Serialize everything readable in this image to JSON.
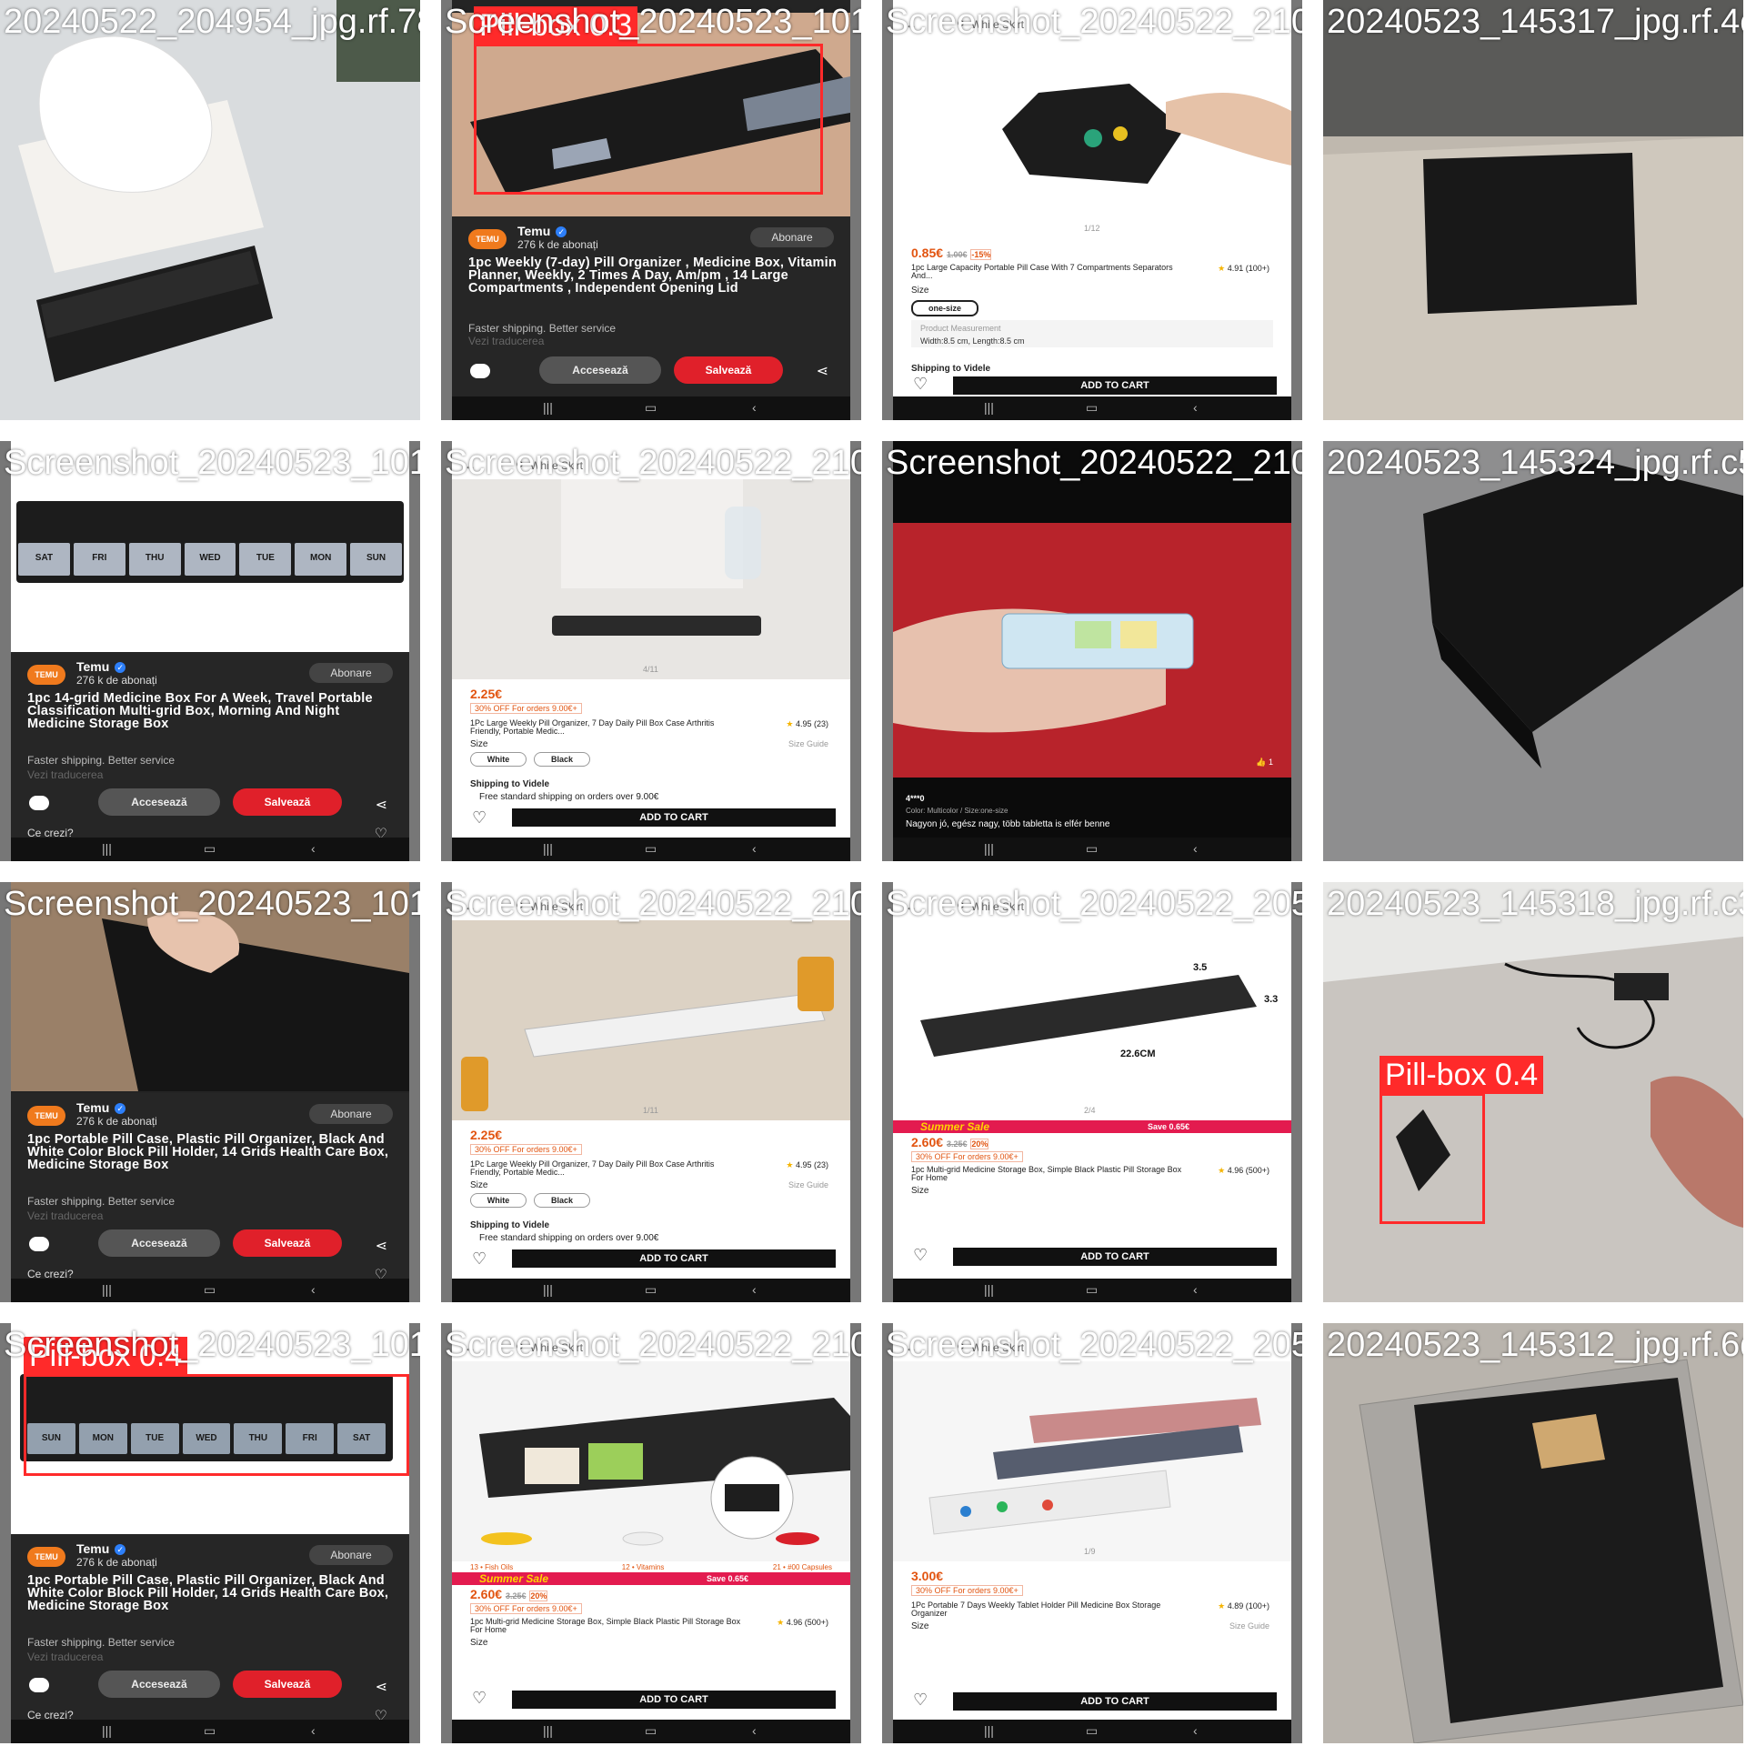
{
  "tiles": [
    {
      "filename": "20240522_204954_jpg.rf.783…"
    },
    {
      "filename": "Screenshot_20240523_10115…",
      "detection": {
        "label": "Pill-box 0.3"
      },
      "post": {
        "seller": "Temu",
        "subscribers": "276 k de abonați",
        "follow": "Abonare",
        "title": "1pc Weekly (7-day) Pill Organizer , Medicine Box, Vitamin Planner, Weekly, 2 Times A Day, Am/pm , 14 Large Compartments , Independent Opening Lid",
        "faster": "Faster shipping. Better service",
        "translate": "Vezi traducerea",
        "access": "Accesează",
        "save": "Salvează"
      }
    },
    {
      "filename": "Screenshot_20240522_21012…",
      "shop": {
        "search": "White Skirt",
        "price": "0.85€",
        "old_price": "1.00€",
        "discount": "-15%",
        "desc": "1pc Large Capacity Portable Pill Case With 7 Compartments Separators And...",
        "rating": "4.91 (100+)",
        "size_label": "Size",
        "size_value": "one-size",
        "measure": "Product Measurement",
        "measure_value": "Width:8.5 cm, Length:8.5 cm",
        "ship": "Shipping to Videle",
        "cart": "ADD TO CART",
        "counter": "1/12"
      }
    },
    {
      "filename": "20240523_145317_jpg.rf.4c…"
    },
    {
      "filename": "Screenshot_20240523_10117…",
      "post": {
        "seller": "Temu",
        "subscribers": "276 k de abonați",
        "follow": "Abonare",
        "title": "1pc 14-grid Medicine Box For A Week, Travel Portable Classification Multi-grid Box, Morning And Night Medicine Storage Box",
        "faster": "Faster shipping. Better service",
        "translate": "Vezi traducerea",
        "access": "Accesează",
        "save": "Salvează",
        "ce": "Ce crezi?"
      },
      "days": [
        "SAT",
        "FRI",
        "THU",
        "WED",
        "TUE",
        "MON",
        "SUN"
      ]
    },
    {
      "filename": "Screenshot_20240522_21024…",
      "shop": {
        "search": "White Skirt",
        "price": "2.25€",
        "promo": "30% OFF For orders 9.00€+",
        "desc": "1Pc Large Weekly Pill Organizer, 7 Day Daily Pill Box Case Arthritis Friendly, Portable Medic...",
        "rating": "4.95 (23)",
        "size_label": "Size",
        "size_guide": "Size Guide",
        "chips": [
          "White",
          "Black"
        ],
        "ship": "Shipping to Videle",
        "ship_note": "Free standard shipping on orders over 9.00€",
        "cart": "ADD TO CART",
        "counter": "4/11"
      }
    },
    {
      "filename": "Screenshot_20240522_21005…",
      "review": {
        "user": "4***0",
        "variant": "Color: Multicolor / Size:one-size",
        "text": "Nagyon jó, egész nagy, több tabletta is elfér benne",
        "likes": "1"
      }
    },
    {
      "filename": "20240523_145324_jpg.rf.c5…"
    },
    {
      "filename": "Screenshot_20240523_10123…",
      "post": {
        "seller": "Temu",
        "subscribers": "276 k de abonați",
        "follow": "Abonare",
        "title": "1pc Portable Pill Case, Plastic Pill Organizer, Black And White Color Block Pill Holder, 14 Grids Health Care Box, Medicine Storage Box",
        "faster": "Faster shipping. Better service",
        "translate": "Vezi traducerea",
        "access": "Accesează",
        "save": "Salvează",
        "ce": "Ce crezi?"
      }
    },
    {
      "filename": "Screenshot_20240522_21023…",
      "shop": {
        "search": "White Skirt",
        "price": "2.25€",
        "promo": "30% OFF For orders 9.00€+",
        "desc": "1Pc Large Weekly Pill Organizer, 7 Day Daily Pill Box Case Arthritis Friendly, Portable Medic...",
        "rating": "4.95 (23)",
        "size_label": "Size",
        "size_guide": "Size Guide",
        "chips": [
          "White",
          "Black"
        ],
        "ship": "Shipping to Videle",
        "ship_note": "Free standard shipping on orders over 9.00€",
        "cart": "ADD TO CART",
        "counter": "1/11"
      }
    },
    {
      "filename": "Screenshot_20240522_20592…",
      "shop": {
        "search": "White Skirt",
        "price": "2.60€",
        "old_price": "3.25€",
        "discount": "20%",
        "promo": "30% OFF For orders 9.00€+",
        "sale": "Summer Sale",
        "save_amt": "Save 0.65€",
        "desc": "1pc Multi-grid Medicine Storage Box, Simple Black Plastic Pill Storage Box For Home",
        "rating": "4.96 (500+)",
        "size_label": "Size",
        "cart": "ADD TO CART",
        "counter": "2/4",
        "dims": [
          "3.5",
          "3.3",
          "22.6CM"
        ]
      }
    },
    {
      "filename": "20240523_145318_jpg.rf.c3…",
      "detection": {
        "label": "Pill-box 0.4"
      }
    },
    {
      "filename": "Screenshot_20240523_10123…",
      "detection": {
        "label": "Pill-box 0.4"
      },
      "post": {
        "seller": "Temu",
        "subscribers": "276 k de abonați",
        "follow": "Abonare",
        "title": "1pc Portable Pill Case, Plastic Pill Organizer, Black And White Color Block Pill Holder, 14 Grids Health Care Box, Medicine Storage Box",
        "faster": "Faster shipping. Better service",
        "translate": "Vezi traducerea",
        "access": "Accesează",
        "save": "Salvează",
        "ce": "Ce crezi?"
      },
      "days": [
        "SUN",
        "MON",
        "TUE",
        "WED",
        "THU",
        "FRI",
        "SAT"
      ]
    },
    {
      "filename": "Screenshot_20240522_21023…",
      "shop": {
        "search": "White Skirt",
        "price": "2.60€",
        "old_price": "3.25€",
        "discount": "20%",
        "promo": "30% OFF For orders 9.00€+",
        "sale": "Summer Sale",
        "save_amt": "Save 0.65€",
        "desc": "1pc Multi-grid Medicine Storage Box, Simple Black Plastic Pill Storage Box For Home",
        "rating": "4.96 (500+)",
        "size_label": "Size",
        "cart": "ADD TO CART",
        "counter": "1/4",
        "legend": [
          "13 • Fish Oils",
          "12 • Vitamins",
          "21 • #00 Capsules"
        ]
      }
    },
    {
      "filename": "Screenshot_20240522_20572…",
      "shop": {
        "search": "White Skirt",
        "price": "3.00€",
        "promo": "30% OFF For orders 9.00€+",
        "desc": "1Pc Portable 7 Days Weekly Tablet Holder Pill Medicine Box Storage Organizer",
        "rating": "4.89 (100+)",
        "size_label": "Size",
        "size_guide": "Size Guide",
        "cart": "ADD TO CART",
        "counter": "1/9"
      }
    },
    {
      "filename": "20240523_145312_jpg.rf.6d…"
    }
  ],
  "colors": {
    "detection": "#ff2a2a",
    "temu": "#f07a1d",
    "save": "#e0202a",
    "price": "#e25410"
  }
}
